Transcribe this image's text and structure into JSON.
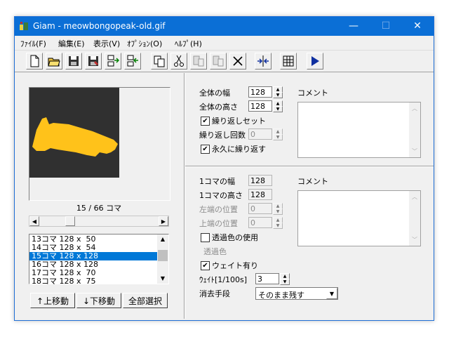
{
  "window": {
    "title": "Giam - meowbongopeak-old.gif",
    "min": "—",
    "max": "☐",
    "close": "✕"
  },
  "menu": [
    "ﾌｧｲﾙ(F)",
    "編集(E)",
    "表示(V)",
    "ｵﾌﾟｼｮﾝ(O)",
    "ﾍﾙﾌﾟ(H)"
  ],
  "preview": {
    "frame_counter": "15 / 66 コマ",
    "bg_color": "#303030",
    "cat_color": "#ffc21a"
  },
  "frame_list": [
    "13コマ 128 x  50",
    "14コマ 128 x  54",
    "15コマ 128 x 128",
    "16コマ 128 x 128",
    "17コマ 128 x  70",
    "18コマ 128 x  75"
  ],
  "frame_list_selected_index": 2,
  "buttons": {
    "move_up": "↑上移動",
    "move_down": "↓下移動",
    "select_all": "全部選択"
  },
  "global": {
    "width_label": "全体の幅",
    "width_value": "128",
    "height_label": "全体の高さ",
    "height_value": "128",
    "loop_set_label": "繰り返しセット",
    "loop_count_label": "繰り返し回数",
    "loop_count_value": "0",
    "loop_forever_label": "永久に繰り返す",
    "comment_label": "コメント"
  },
  "frame": {
    "width_label": "1コマの幅",
    "width_value": "128",
    "height_label": "1コマの高さ",
    "height_value": "128",
    "left_label": "左端の位置",
    "left_value": "0",
    "top_label": "上端の位置",
    "top_value": "0",
    "transparent_label": "透過色の使用",
    "transparent_color_label": "透過色",
    "wait_label": "ウェイト有り",
    "wait_value_label": "ｳｪｲﾄ[1/100s]",
    "wait_value": "3",
    "disposal_label": "消去手段",
    "disposal_value": "そのまま残す",
    "comment_label": "コメント"
  }
}
